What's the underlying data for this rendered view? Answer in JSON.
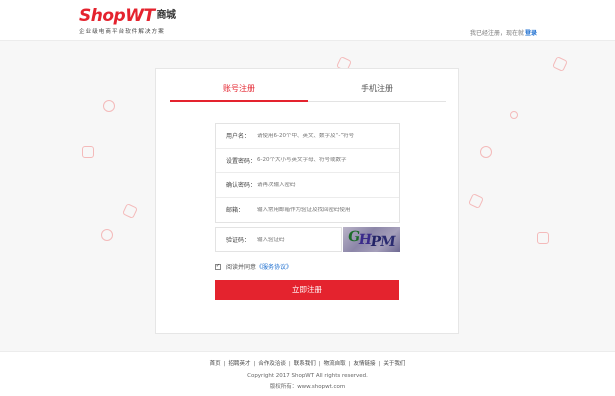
{
  "header": {
    "logo_text": "ShopWT",
    "logo_cn": "商城",
    "slogan": "企业级电商平台软件解决方案",
    "login_prompt": "我已经注册，现在就",
    "login_link": "登录"
  },
  "tabs": [
    {
      "label": "账号注册",
      "active": true
    },
    {
      "label": "手机注册",
      "active": false
    }
  ],
  "form": {
    "fields": [
      {
        "label": "用户名：",
        "placeholder": "请使用6-20个中、英文、数字及“-”符号"
      },
      {
        "label": "设置密码：",
        "placeholder": "6-20个大小写英文字母、符号或数字"
      },
      {
        "label": "确认密码：",
        "placeholder": "请再次输入密码"
      },
      {
        "label": "邮箱：",
        "placeholder": "输入常用邮箱作为验证及找回密码使用"
      }
    ],
    "captcha": {
      "label": "验证码：",
      "placeholder": "输入验证码",
      "image_text": "GHPM"
    },
    "agree_text": "阅读并同意",
    "agree_link": "《服务协议》",
    "agree_checked": true,
    "submit_label": "立即注册"
  },
  "footer": {
    "links": [
      "首页",
      "招聘英才",
      "合作及洽谈",
      "联系我们",
      "物流自取",
      "友情链接",
      "关于我们"
    ],
    "copyright": "Copyright 2017 ShopWT All rights reserved.",
    "rights": "版权所有：www.shopwt.com"
  },
  "colors": {
    "brand": "#e4232e",
    "link": "#1e6fd0"
  }
}
